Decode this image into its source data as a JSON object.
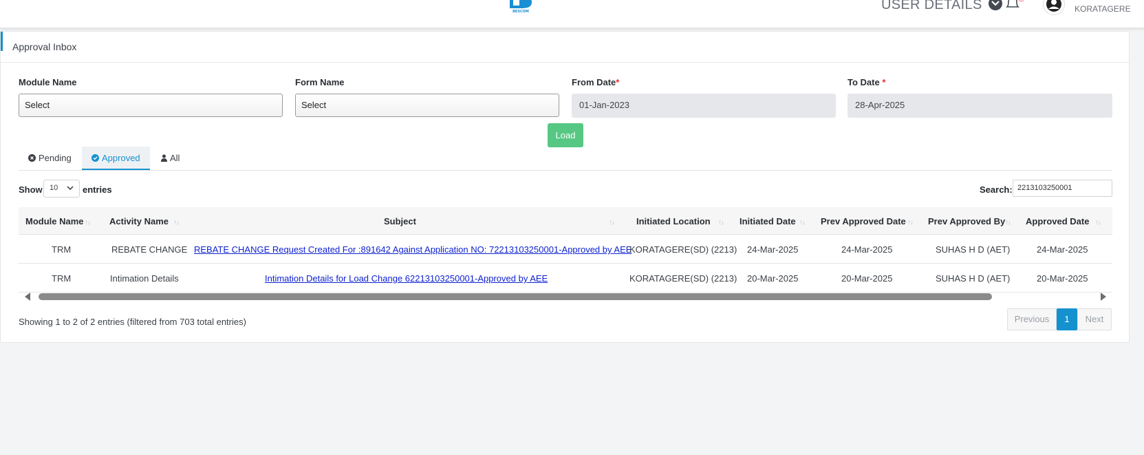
{
  "header": {
    "logo_text": "BESCOM",
    "user_details_label": "USER DETAILS",
    "user_location": "KORATAGERE"
  },
  "page": {
    "title": "Approval Inbox"
  },
  "filters": {
    "module_name": {
      "label": "Module Name",
      "value": "Select"
    },
    "form_name": {
      "label": "Form Name",
      "value": "Select"
    },
    "from_date": {
      "label": "From Date",
      "required_mark": "*",
      "value": "01-Jan-2023"
    },
    "to_date": {
      "label": "To Date",
      "required_mark": "*",
      "value": "28-Apr-2025"
    },
    "load_label": "Load"
  },
  "tabs": [
    {
      "label": "Pending",
      "icon": "times-circle-icon"
    },
    {
      "label": "Approved",
      "icon": "check-circle-icon",
      "active": true
    },
    {
      "label": "All",
      "icon": "user-icon"
    }
  ],
  "table_controls": {
    "show_label": "Show",
    "entries_value": "10",
    "entries_label": "entries",
    "search_label": "Search:",
    "search_value": "2213103250001"
  },
  "table": {
    "columns": [
      "Module Name",
      "Activity Name",
      "Subject",
      "Initiated Location",
      "Initiated Date",
      "Prev Approved Date",
      "Prev Approved By",
      "Approved Date"
    ],
    "rows": [
      [
        "TRM",
        "REBATE CHANGE",
        "REBATE CHANGE Request Created For :891642 Against Application NO: 72213103250001-Approved by AEE",
        "KORATAGERE(SD) (2213)",
        "24-Mar-2025",
        "24-Mar-2025",
        "SUHAS H D (AET)",
        "24-Mar-2025"
      ],
      [
        "TRM",
        "Intimation Details",
        "Intimation Details for Load Change 62213103250001-Approved by AEE",
        "KORATAGERE(SD) (2213)",
        "20-Mar-2025",
        "20-Mar-2025",
        "SUHAS H D (AET)",
        "20-Mar-2025"
      ]
    ]
  },
  "footer": {
    "showing_text": "Showing 1 to 2 of 2 entries (filtered from 703 total entries)",
    "previous_label": "Previous",
    "current_page": "1",
    "next_label": "Next"
  },
  "colors": {
    "accent": "#1591cf",
    "load_button": "#57c784",
    "link": "#0b1fd1"
  }
}
